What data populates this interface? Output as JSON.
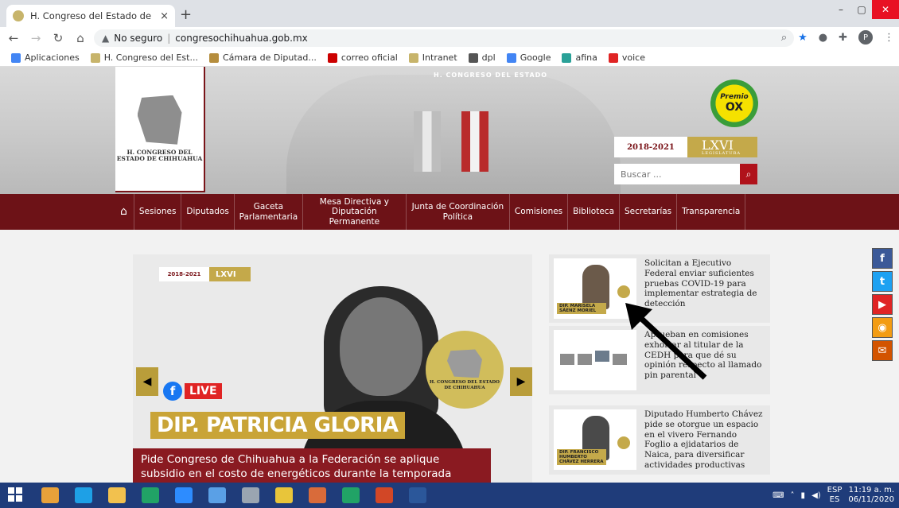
{
  "browser": {
    "tab_title": "H. Congreso del Estado de Chihu",
    "tab_close": "×",
    "new_tab": "+",
    "security_label": "No seguro",
    "url": "congresochihuahua.gob.mx",
    "profile_initial": "P",
    "window_controls": [
      "–",
      "▢",
      "✕"
    ]
  },
  "bookmarks": [
    {
      "label": "Aplicaciones",
      "color": "#4285f4"
    },
    {
      "label": "H. Congreso del Est...",
      "color": "#c7b46b"
    },
    {
      "label": "Cámara de Diputad...",
      "color": "#b58d3d"
    },
    {
      "label": "correo oficial",
      "color": "#cc0000"
    },
    {
      "label": "Intranet",
      "color": "#c7b46b"
    },
    {
      "label": "dpl",
      "color": "#555555"
    },
    {
      "label": "Google",
      "color": "#4285f4"
    },
    {
      "label": "afina",
      "color": "#2aa198"
    },
    {
      "label": "voice",
      "color": "#e02424"
    }
  ],
  "header": {
    "logo_text": "H. CONGRESO DEL ESTADO DE CHIHUAHUA",
    "chamber_text": "H. CONGRESO DEL ESTADO",
    "legislature_years": "2018-2021",
    "legislature_name": "LXVI",
    "legislature_sub": "LEGISLATURA",
    "premio_label": "Premio",
    "premio_mark": "OX",
    "search_placeholder": "Buscar ..."
  },
  "menu": [
    "Sesiones",
    "Diputados",
    "Gaceta Parlamentaria",
    "Mesa Directiva y Diputación Permanente",
    "Junta de Coordinación Política",
    "Comisiones",
    "Biblioteca",
    "Secretarías",
    "Transparencia"
  ],
  "slider": {
    "badge_years": "2018-2021",
    "badge_name": "LXVI",
    "live_label": "LIVE",
    "name_banner": "DIP. PATRICIA GLORIA",
    "seal_text": "H. CONGRESO DEL ESTADO DE CHIHUAHUA",
    "caption": "Pide Congreso de Chihuahua a la Federación se aplique subsidio en el costo de energéticos durante la temporada invernal"
  },
  "news": [
    {
      "title": "Solicitan a Ejecutivo Federal enviar suficientes pruebas COVID-19 para implementar estrategia de detección",
      "badge": "DIP. MARISELA SÁENZ MORIEL"
    },
    {
      "title": "Aprueban en comisiones exhortar al titular de la CEDH para que dé su opinión respecto al llamado pin parental",
      "badge": ""
    },
    {
      "title": "Diputado Humberto Chávez pide se otorgue un espacio en el vivero Fernando Foglio a ejidatarios de Naica, para diversificar actividades productivas",
      "badge": "DIP. FRANCISCO HUMBERTO CHÁVEZ HERRERA"
    }
  ],
  "social": [
    {
      "name": "facebook",
      "glyph": "f",
      "color": "#3b5998"
    },
    {
      "name": "twitter",
      "glyph": "t",
      "color": "#1da1f2"
    },
    {
      "name": "youtube",
      "glyph": "▶",
      "color": "#e02424"
    },
    {
      "name": "rss",
      "glyph": "◉",
      "color": "#f39c12"
    },
    {
      "name": "email",
      "glyph": "✉",
      "color": "#d35400"
    }
  ],
  "taskbar": {
    "apps": [
      {
        "name": "start",
        "color": "#ffffff"
      },
      {
        "name": "chrome",
        "color": "#e8a13a"
      },
      {
        "name": "internet-explorer",
        "color": "#1ea0e6"
      },
      {
        "name": "file-explorer",
        "color": "#f2c14e"
      },
      {
        "name": "store",
        "color": "#21a366"
      },
      {
        "name": "zoom",
        "color": "#2d8cff"
      },
      {
        "name": "computer",
        "color": "#5aa0e6"
      },
      {
        "name": "calculator",
        "color": "#9aa5b1"
      },
      {
        "name": "lock",
        "color": "#e8c53a"
      },
      {
        "name": "paint",
        "color": "#d96b3a"
      },
      {
        "name": "excel",
        "color": "#21a366"
      },
      {
        "name": "powerpoint",
        "color": "#d24726"
      },
      {
        "name": "word",
        "color": "#2b579a"
      }
    ],
    "lang_top": "ESP",
    "lang_bottom": "ES",
    "time": "11:19 a. m.",
    "date": "06/11/2020"
  }
}
